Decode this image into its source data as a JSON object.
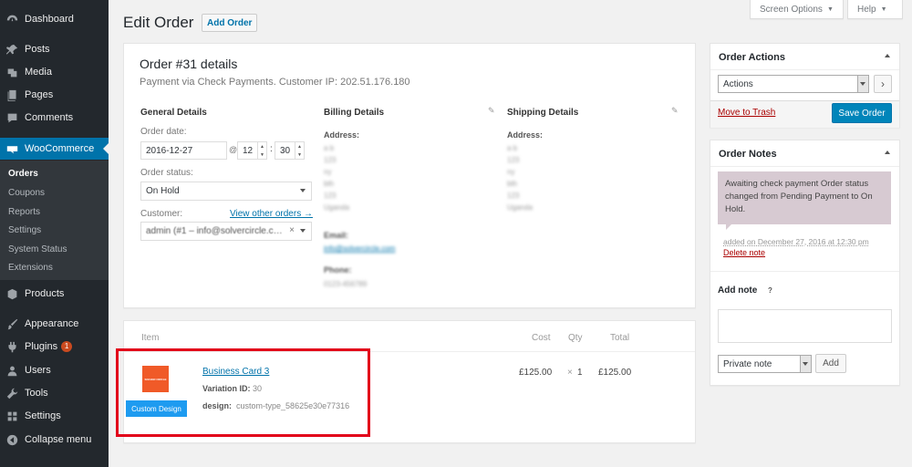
{
  "sidebar": {
    "items": [
      {
        "label": "Dashboard",
        "icon": "dashboard-icon"
      },
      {
        "label": "Posts",
        "icon": "pin-icon"
      },
      {
        "label": "Media",
        "icon": "media-icon"
      },
      {
        "label": "Pages",
        "icon": "pages-icon"
      },
      {
        "label": "Comments",
        "icon": "comment-icon"
      },
      {
        "label": "WooCommerce",
        "icon": "woocommerce-icon"
      },
      {
        "label": "Products",
        "icon": "box-icon"
      },
      {
        "label": "Appearance",
        "icon": "brush-icon"
      },
      {
        "label": "Plugins",
        "icon": "plugin-icon",
        "badge": "1"
      },
      {
        "label": "Users",
        "icon": "users-icon"
      },
      {
        "label": "Tools",
        "icon": "wrench-icon"
      },
      {
        "label": "Settings",
        "icon": "settings-icon"
      },
      {
        "label": "Collapse menu",
        "icon": "collapse-icon"
      }
    ],
    "submenu": [
      "Orders",
      "Coupons",
      "Reports",
      "Settings",
      "System Status",
      "Extensions"
    ]
  },
  "header": {
    "title": "Edit Order",
    "add_order": "Add Order",
    "screen_options": "Screen Options",
    "help": "Help"
  },
  "order": {
    "heading": "Order #31 details",
    "meta": "Payment via Check Payments. Customer IP: 202.51.176.180",
    "general_title": "General Details",
    "billing_title": "Billing Details",
    "shipping_title": "Shipping Details",
    "order_date_label": "Order date:",
    "order_date": "2016-12-27",
    "at": "@",
    "hour": "12",
    "colon": ":",
    "minute": "30",
    "status_label": "Order status:",
    "status": "On Hold",
    "customer_label": "Customer:",
    "view_other_orders": "View other orders →",
    "customer": "admin (#1 – info@solvercircle.c…",
    "clear": "×",
    "address_label": "Address:",
    "email_label": "Email:",
    "phone_label": "Phone:",
    "billing_address": [
      "a b",
      "123",
      "ny",
      "bth",
      "123",
      "Uganda"
    ],
    "billing_email": "info@solvercircle.com",
    "billing_phone": "0123-456789",
    "shipping_address": [
      "a b",
      "123",
      "ny",
      "bth",
      "123",
      "Uganda"
    ]
  },
  "items": {
    "headers": {
      "item": "Item",
      "cost": "Cost",
      "qty": "Qty",
      "total": "Total"
    },
    "rows": [
      {
        "name": "Business Card 3",
        "thumb_logo": "SOLVER CIRCLE",
        "custom_button": "Custom Design",
        "variation_label": "Variation ID:",
        "variation_id": "30",
        "design_label": "design:",
        "design_value": "custom-type_58625e30e77316",
        "cost": "£125.00",
        "qty_x": "×",
        "qty": "1",
        "total": "£125.00"
      }
    ]
  },
  "order_actions": {
    "title": "Order Actions",
    "select": "Actions",
    "go": "›",
    "trash": "Move to Trash",
    "save": "Save Order"
  },
  "order_notes": {
    "title": "Order Notes",
    "note_text": "Awaiting check payment Order status changed from Pending Payment to On Hold.",
    "note_meta": "added on December 27, 2016 at 12:30 pm",
    "delete": "Delete note",
    "add_note_label": "Add note",
    "help": "?",
    "note_type": "Private note",
    "add_button": "Add"
  },
  "colors": {
    "accent": "#0073aa",
    "sidebar": "#23282d",
    "highlight": "#e2001a",
    "note_bg": "#d7cad2"
  }
}
